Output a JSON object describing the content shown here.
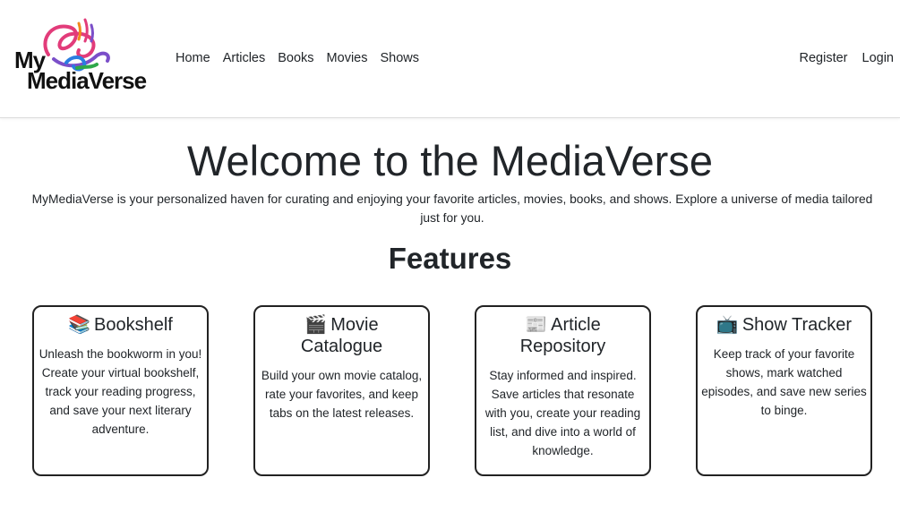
{
  "brand": {
    "line1": "My",
    "line2": "MediaVerse"
  },
  "nav": {
    "links": [
      "Home",
      "Articles",
      "Books",
      "Movies",
      "Shows"
    ],
    "register": "Register",
    "login": "Login"
  },
  "hero": {
    "title": "Welcome to the MediaVerse",
    "text": "MyMediaVerse is your personalized haven for curating and enjoying your favorite articles, movies, books, and shows. Explore a universe of media tailored just for you."
  },
  "features": {
    "title": "Features",
    "cards": [
      {
        "icon": "📚",
        "icon_name": "books-icon",
        "title": "Bookshelf",
        "desc": "Unleash the bookworm in you! Create your virtual bookshelf, track your reading progress, and save your next literary adventure."
      },
      {
        "icon": "🎬",
        "icon_name": "clapperboard-icon",
        "title": "Movie Catalogue",
        "desc": "Build your own movie catalog, rate your favorites, and keep tabs on the latest releases."
      },
      {
        "icon": "📰",
        "icon_name": "newspaper-icon",
        "title": "Article Repository",
        "desc": "Stay informed and inspired. Save articles that resonate with you, create your reading list, and dive into a world of knowledge."
      },
      {
        "icon": "📺",
        "icon_name": "television-icon",
        "title": "Show Tracker",
        "desc": "Keep track of your favorite shows, mark watched episodes, and save new series to binge."
      }
    ]
  },
  "colors": {
    "text": "#212529",
    "card_border": "#222222",
    "logo_pink": "#e23c7a",
    "logo_purple": "#7b4fc9",
    "logo_blue": "#2b7de0",
    "logo_green": "#2ea84a",
    "logo_orange": "#f08a1c"
  }
}
